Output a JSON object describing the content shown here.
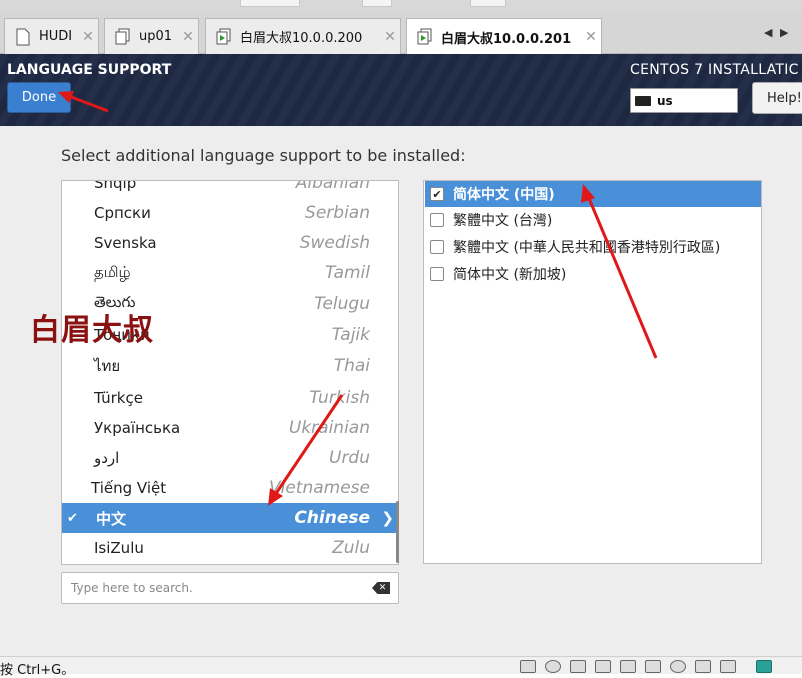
{
  "tabs": [
    {
      "label": "HUDI",
      "icon": "document-icon"
    },
    {
      "label": "up01",
      "icon": "document-icon"
    },
    {
      "label": "白眉大叔10.0.0.200",
      "icon": "vm-play-icon"
    },
    {
      "label": "白眉大叔10.0.0.201",
      "icon": "vm-play-icon",
      "active": true
    }
  ],
  "tab_close": "✕",
  "header": {
    "title": "LANGUAGE SUPPORT",
    "done_label": "Done",
    "product": "CENTOS 7 INSTALLATIC",
    "keyboard": "us",
    "help_label": "Help!"
  },
  "prompt": "Select additional language support to be installed:",
  "languages": [
    {
      "native": "Shqip",
      "english": "Albanian"
    },
    {
      "native": "Српски",
      "english": "Serbian"
    },
    {
      "native": "Svenska",
      "english": "Swedish"
    },
    {
      "native": "தமிழ்",
      "english": "Tamil"
    },
    {
      "native": "తెలుగు",
      "english": "Telugu"
    },
    {
      "native": "Тоҷикӣ",
      "english": "Tajik"
    },
    {
      "native": "ไทย",
      "english": "Thai"
    },
    {
      "native": "Türkçe",
      "english": "Turkish"
    },
    {
      "native": "Українська",
      "english": "Ukrainian"
    },
    {
      "native": "اردو",
      "english": "Urdu"
    },
    {
      "native": "Tiếng Việt",
      "english": "Vietnamese"
    },
    {
      "native": "中文",
      "english": "Chinese",
      "selected": true
    },
    {
      "native": "IsiZulu",
      "english": "Zulu"
    }
  ],
  "search": {
    "placeholder": "Type here to search."
  },
  "locales": [
    {
      "label": "简体中文 (中国)",
      "checked": true
    },
    {
      "label": "繁體中文 (台灣)",
      "checked": false
    },
    {
      "label": "繁體中文 (中華人民共和國香港特別行政區)",
      "checked": false
    },
    {
      "label": "简体中文 (新加坡)",
      "checked": false
    }
  ],
  "watermark": "白眉大叔",
  "status_text": "按 Ctrl+G。",
  "colors": {
    "accent": "#4a90d9",
    "header_bg": "#1f2a44",
    "arrow": "#e01818",
    "watermark": "#8b1010"
  }
}
